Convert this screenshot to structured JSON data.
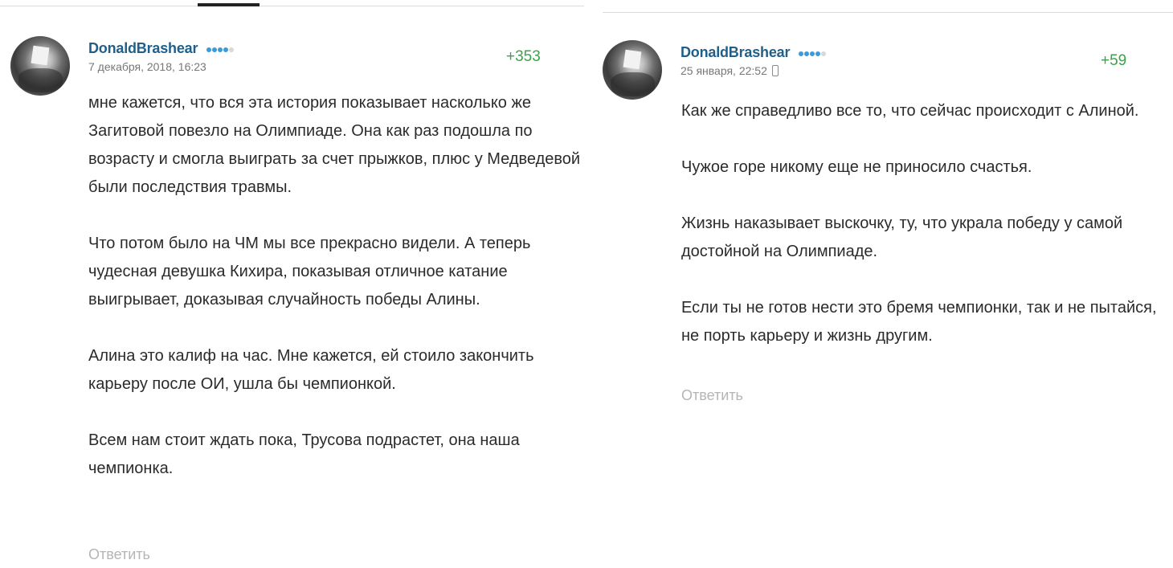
{
  "comments": [
    {
      "username": "DonaldBrashear",
      "rank_dots": {
        "filled": 4,
        "empty": 1,
        "color": "#3a9bd8"
      },
      "date": "7 декабря, 2018, 16:23",
      "rating": "+353",
      "paragraphs": [
        "мне кажется, что вся эта история показывает насколько же Загитовой повезло на Олимпиаде. Она как раз подошла по возрасту и смогла выиграть за счет прыжков, плюс у Медведевой были последствия травмы.",
        "Что потом было на ЧМ мы все прекрасно видели. А теперь чудесная девушка Кихира, показывая отличное катание выигрывает, доказывая случайность победы Алины.",
        "Алина это калиф на час. Мне кажется, ей стоило закончить карьеру после ОИ, ушла бы чемпионкой.",
        "Всем нам стоит ждать пока, Трусова подрастет, она наша чемпионка."
      ],
      "reply_label": "Ответить"
    },
    {
      "username": "DonaldBrashear",
      "rank_dots": {
        "filled": 4,
        "empty": 1,
        "color": "#3a9bd8"
      },
      "date": "25 января, 22:52",
      "device_icon": "mobile-phone-icon",
      "rating": "+59",
      "paragraphs": [
        "Как же справедливо все то, что сейчас происходит с Алиной.",
        "Чужое горе никому еще не приносило счастья.",
        "Жизнь наказывает выскочку, ту, что украла победу у самой достойной на Олимпиаде.",
        "Если ты не готов нести это бремя чемпионки, так и не пытайся, не порть карьеру и жизнь другим."
      ],
      "reply_label": "Ответить"
    }
  ],
  "colors": {
    "username": "#1f5f8a",
    "rating": "#3aa34a",
    "reply": "#b5b5b5"
  }
}
